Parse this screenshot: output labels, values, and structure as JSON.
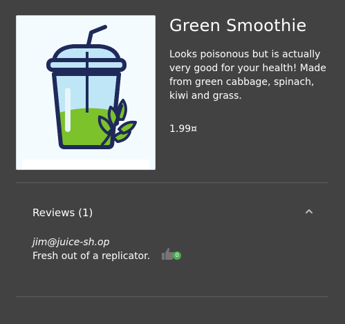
{
  "product": {
    "name": "Green Smoothie",
    "description": "Looks poisonous but is actually very good for your health! Made from green cabbage, spinach, kiwi and grass.",
    "price": "1.99¤",
    "image_icon": "smoothie-cup-icon"
  },
  "reviews": {
    "title": "Reviews (1)",
    "expanded": true,
    "items": [
      {
        "author": "jim@juice-sh.op",
        "text": "Fresh out of a replicator.",
        "likes": "0"
      }
    ]
  },
  "colors": {
    "background": "#424242",
    "accent": "#4caf50",
    "smoothie_green": "#7cc22a",
    "cup_outline": "#1f2a5a"
  }
}
